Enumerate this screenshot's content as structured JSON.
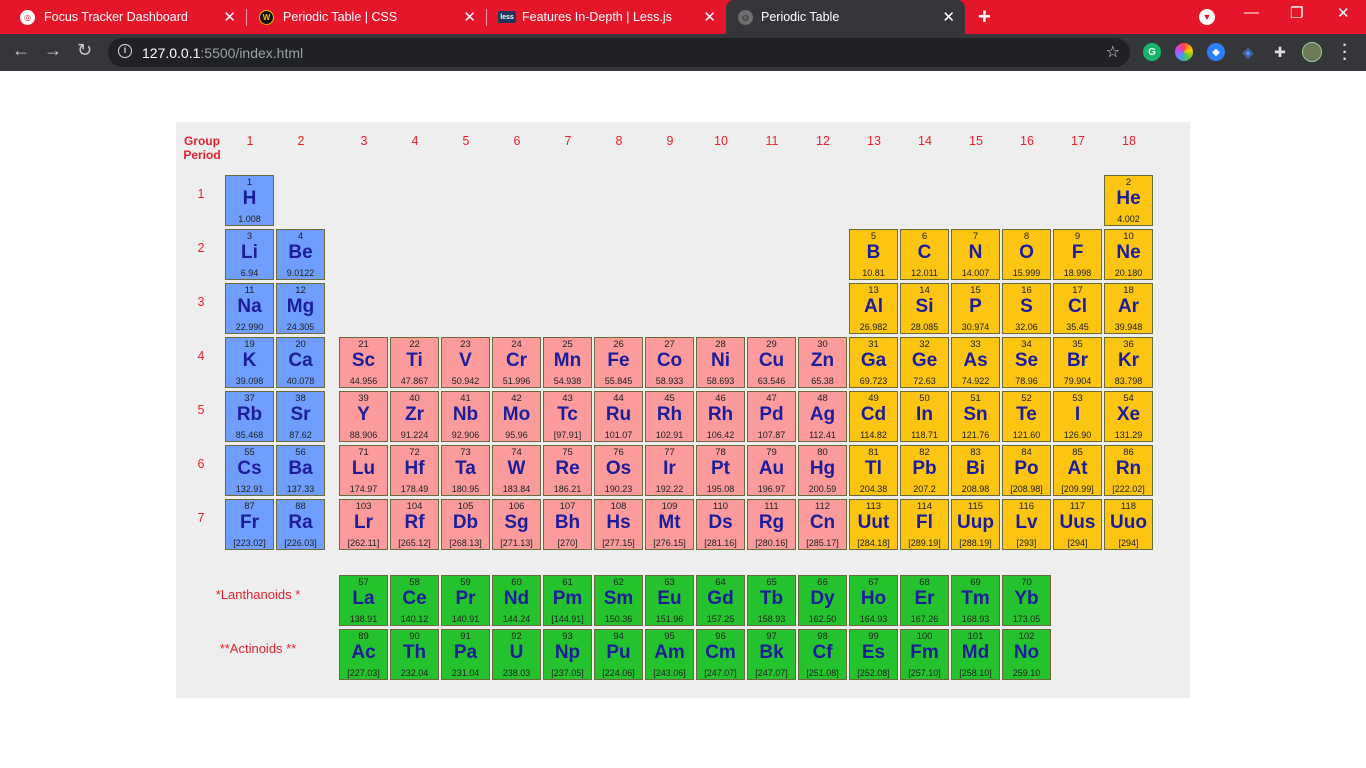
{
  "browser": {
    "tabs": [
      {
        "title": "Focus Tracker Dashboard",
        "icon": "focus-tracker-icon"
      },
      {
        "title": "Periodic Table | CSS",
        "icon": "css-icon"
      },
      {
        "title": "Features In-Depth | Less.js",
        "icon": "less-icon"
      },
      {
        "title": "Periodic Table",
        "icon": "globe-icon",
        "active": true
      }
    ],
    "url_host": "127.0.0.1",
    "url_path": ":5500/index.html",
    "less_badge": "less"
  },
  "table": {
    "group_label": "Group",
    "period_label": "Period",
    "groups": [
      "1",
      "2",
      "3",
      "4",
      "5",
      "6",
      "7",
      "8",
      "9",
      "10",
      "11",
      "12",
      "13",
      "14",
      "15",
      "16",
      "17",
      "18"
    ],
    "periods": [
      "1",
      "2",
      "3",
      "4",
      "5",
      "6",
      "7"
    ],
    "lanthanoids_label": "*Lanthanoids *",
    "actinoids_label": "**Actinoids **",
    "colors": {
      "alkali": "#6f9eff",
      "transition": "#fb9b9b",
      "other": "#fcc512",
      "fblock": "#24c32d",
      "header": "#e8222d"
    },
    "elements": [
      {
        "n": "1",
        "s": "H",
        "m": "1.008",
        "g": 1,
        "p": 1,
        "c": "alkali"
      },
      {
        "n": "2",
        "s": "He",
        "m": "4.002",
        "g": 18,
        "p": 1,
        "c": "other"
      },
      {
        "n": "3",
        "s": "Li",
        "m": "6.94",
        "g": 1,
        "p": 2,
        "c": "alkali"
      },
      {
        "n": "4",
        "s": "Be",
        "m": "9.0122",
        "g": 2,
        "p": 2,
        "c": "alkali"
      },
      {
        "n": "5",
        "s": "B",
        "m": "10.81",
        "g": 13,
        "p": 2,
        "c": "other"
      },
      {
        "n": "6",
        "s": "C",
        "m": "12.011",
        "g": 14,
        "p": 2,
        "c": "other"
      },
      {
        "n": "7",
        "s": "N",
        "m": "14.007",
        "g": 15,
        "p": 2,
        "c": "other"
      },
      {
        "n": "8",
        "s": "O",
        "m": "15.999",
        "g": 16,
        "p": 2,
        "c": "other"
      },
      {
        "n": "9",
        "s": "F",
        "m": "18.998",
        "g": 17,
        "p": 2,
        "c": "other"
      },
      {
        "n": "10",
        "s": "Ne",
        "m": "20.180",
        "g": 18,
        "p": 2,
        "c": "other"
      },
      {
        "n": "11",
        "s": "Na",
        "m": "22.990",
        "g": 1,
        "p": 3,
        "c": "alkali"
      },
      {
        "n": "12",
        "s": "Mg",
        "m": "24.305",
        "g": 2,
        "p": 3,
        "c": "alkali"
      },
      {
        "n": "13",
        "s": "Al",
        "m": "26.982",
        "g": 13,
        "p": 3,
        "c": "other"
      },
      {
        "n": "14",
        "s": "Si",
        "m": "28.085",
        "g": 14,
        "p": 3,
        "c": "other"
      },
      {
        "n": "15",
        "s": "P",
        "m": "30.974",
        "g": 15,
        "p": 3,
        "c": "other"
      },
      {
        "n": "16",
        "s": "S",
        "m": "32.06",
        "g": 16,
        "p": 3,
        "c": "other"
      },
      {
        "n": "17",
        "s": "Cl",
        "m": "35.45",
        "g": 17,
        "p": 3,
        "c": "other"
      },
      {
        "n": "18",
        "s": "Ar",
        "m": "39.948",
        "g": 18,
        "p": 3,
        "c": "other"
      },
      {
        "n": "19",
        "s": "K",
        "m": "39.098",
        "g": 1,
        "p": 4,
        "c": "alkali"
      },
      {
        "n": "20",
        "s": "Ca",
        "m": "40.078",
        "g": 2,
        "p": 4,
        "c": "alkali"
      },
      {
        "n": "21",
        "s": "Sc",
        "m": "44.956",
        "g": 3,
        "p": 4,
        "c": "transition"
      },
      {
        "n": "22",
        "s": "Ti",
        "m": "47.867",
        "g": 4,
        "p": 4,
        "c": "transition"
      },
      {
        "n": "23",
        "s": "V",
        "m": "50.942",
        "g": 5,
        "p": 4,
        "c": "transition"
      },
      {
        "n": "24",
        "s": "Cr",
        "m": "51.996",
        "g": 6,
        "p": 4,
        "c": "transition"
      },
      {
        "n": "25",
        "s": "Mn",
        "m": "54.938",
        "g": 7,
        "p": 4,
        "c": "transition"
      },
      {
        "n": "26",
        "s": "Fe",
        "m": "55.845",
        "g": 8,
        "p": 4,
        "c": "transition"
      },
      {
        "n": "27",
        "s": "Co",
        "m": "58.933",
        "g": 9,
        "p": 4,
        "c": "transition"
      },
      {
        "n": "28",
        "s": "Ni",
        "m": "58.693",
        "g": 10,
        "p": 4,
        "c": "transition"
      },
      {
        "n": "29",
        "s": "Cu",
        "m": "63.546",
        "g": 11,
        "p": 4,
        "c": "transition"
      },
      {
        "n": "30",
        "s": "Zn",
        "m": "65.38",
        "g": 12,
        "p": 4,
        "c": "transition"
      },
      {
        "n": "31",
        "s": "Ga",
        "m": "69.723",
        "g": 13,
        "p": 4,
        "c": "other"
      },
      {
        "n": "32",
        "s": "Ge",
        "m": "72.63",
        "g": 14,
        "p": 4,
        "c": "other"
      },
      {
        "n": "33",
        "s": "As",
        "m": "74.922",
        "g": 15,
        "p": 4,
        "c": "other"
      },
      {
        "n": "34",
        "s": "Se",
        "m": "78.96",
        "g": 16,
        "p": 4,
        "c": "other"
      },
      {
        "n": "35",
        "s": "Br",
        "m": "79.904",
        "g": 17,
        "p": 4,
        "c": "other"
      },
      {
        "n": "36",
        "s": "Kr",
        "m": "83.798",
        "g": 18,
        "p": 4,
        "c": "other"
      },
      {
        "n": "37",
        "s": "Rb",
        "m": "85.468",
        "g": 1,
        "p": 5,
        "c": "alkali"
      },
      {
        "n": "38",
        "s": "Sr",
        "m": "87.62",
        "g": 2,
        "p": 5,
        "c": "alkali"
      },
      {
        "n": "39",
        "s": "Y",
        "m": "88.906",
        "g": 3,
        "p": 5,
        "c": "transition"
      },
      {
        "n": "40",
        "s": "Zr",
        "m": "91.224",
        "g": 4,
        "p": 5,
        "c": "transition"
      },
      {
        "n": "41",
        "s": "Nb",
        "m": "92.906",
        "g": 5,
        "p": 5,
        "c": "transition"
      },
      {
        "n": "42",
        "s": "Mo",
        "m": "95.96",
        "g": 6,
        "p": 5,
        "c": "transition"
      },
      {
        "n": "43",
        "s": "Tc",
        "m": "[97.91]",
        "g": 7,
        "p": 5,
        "c": "transition"
      },
      {
        "n": "44",
        "s": "Ru",
        "m": "101.07",
        "g": 8,
        "p": 5,
        "c": "transition"
      },
      {
        "n": "45",
        "s": "Rh",
        "m": "102.91",
        "g": 9,
        "p": 5,
        "c": "transition"
      },
      {
        "n": "46",
        "s": "Rh",
        "m": "106.42",
        "g": 10,
        "p": 5,
        "c": "transition"
      },
      {
        "n": "47",
        "s": "Pd",
        "m": "107.87",
        "g": 11,
        "p": 5,
        "c": "transition"
      },
      {
        "n": "48",
        "s": "Ag",
        "m": "112.41",
        "g": 12,
        "p": 5,
        "c": "transition"
      },
      {
        "n": "49",
        "s": "Cd",
        "m": "114.82",
        "g": 13,
        "p": 5,
        "c": "other"
      },
      {
        "n": "50",
        "s": "In",
        "m": "118.71",
        "g": 14,
        "p": 5,
        "c": "other"
      },
      {
        "n": "51",
        "s": "Sn",
        "m": "121.76",
        "g": 15,
        "p": 5,
        "c": "other"
      },
      {
        "n": "52",
        "s": "Te",
        "m": "121.60",
        "g": 16,
        "p": 5,
        "c": "other"
      },
      {
        "n": "53",
        "s": "I",
        "m": "126.90",
        "g": 17,
        "p": 5,
        "c": "other"
      },
      {
        "n": "54",
        "s": "Xe",
        "m": "131.29",
        "g": 18,
        "p": 5,
        "c": "other"
      },
      {
        "n": "55",
        "s": "Cs",
        "m": "132.91",
        "g": 1,
        "p": 6,
        "c": "alkali"
      },
      {
        "n": "56",
        "s": "Ba",
        "m": "137.33",
        "g": 2,
        "p": 6,
        "c": "alkali"
      },
      {
        "n": "71",
        "s": "Lu",
        "m": "174.97",
        "g": 3,
        "p": 6,
        "c": "transition"
      },
      {
        "n": "72",
        "s": "Hf",
        "m": "178.49",
        "g": 4,
        "p": 6,
        "c": "transition"
      },
      {
        "n": "73",
        "s": "Ta",
        "m": "180.95",
        "g": 5,
        "p": 6,
        "c": "transition"
      },
      {
        "n": "74",
        "s": "W",
        "m": "183.84",
        "g": 6,
        "p": 6,
        "c": "transition"
      },
      {
        "n": "75",
        "s": "Re",
        "m": "186.21",
        "g": 7,
        "p": 6,
        "c": "transition"
      },
      {
        "n": "76",
        "s": "Os",
        "m": "190.23",
        "g": 8,
        "p": 6,
        "c": "transition"
      },
      {
        "n": "77",
        "s": "Ir",
        "m": "192.22",
        "g": 9,
        "p": 6,
        "c": "transition"
      },
      {
        "n": "78",
        "s": "Pt",
        "m": "195.08",
        "g": 10,
        "p": 6,
        "c": "transition"
      },
      {
        "n": "79",
        "s": "Au",
        "m": "196.97",
        "g": 11,
        "p": 6,
        "c": "transition"
      },
      {
        "n": "80",
        "s": "Hg",
        "m": "200.59",
        "g": 12,
        "p": 6,
        "c": "transition"
      },
      {
        "n": "81",
        "s": "Tl",
        "m": "204.38",
        "g": 13,
        "p": 6,
        "c": "other"
      },
      {
        "n": "82",
        "s": "Pb",
        "m": "207.2",
        "g": 14,
        "p": 6,
        "c": "other"
      },
      {
        "n": "83",
        "s": "Bi",
        "m": "208.98",
        "g": 15,
        "p": 6,
        "c": "other"
      },
      {
        "n": "84",
        "s": "Po",
        "m": "[208.98]",
        "g": 16,
        "p": 6,
        "c": "other"
      },
      {
        "n": "85",
        "s": "At",
        "m": "[209.99]",
        "g": 17,
        "p": 6,
        "c": "other"
      },
      {
        "n": "86",
        "s": "Rn",
        "m": "[222.02]",
        "g": 18,
        "p": 6,
        "c": "other"
      },
      {
        "n": "87",
        "s": "Fr",
        "m": "[223.02]",
        "g": 1,
        "p": 7,
        "c": "alkali"
      },
      {
        "n": "88",
        "s": "Ra",
        "m": "[226.03]",
        "g": 2,
        "p": 7,
        "c": "alkali"
      },
      {
        "n": "103",
        "s": "Lr",
        "m": "[262.11]",
        "g": 3,
        "p": 7,
        "c": "transition"
      },
      {
        "n": "104",
        "s": "Rf",
        "m": "[265.12]",
        "g": 4,
        "p": 7,
        "c": "transition"
      },
      {
        "n": "105",
        "s": "Db",
        "m": "[268.13]",
        "g": 5,
        "p": 7,
        "c": "transition"
      },
      {
        "n": "106",
        "s": "Sg",
        "m": "[271.13]",
        "g": 6,
        "p": 7,
        "c": "transition"
      },
      {
        "n": "107",
        "s": "Bh",
        "m": "[270]",
        "g": 7,
        "p": 7,
        "c": "transition"
      },
      {
        "n": "108",
        "s": "Hs",
        "m": "[277.15]",
        "g": 8,
        "p": 7,
        "c": "transition"
      },
      {
        "n": "109",
        "s": "Mt",
        "m": "[276.15]",
        "g": 9,
        "p": 7,
        "c": "transition"
      },
      {
        "n": "110",
        "s": "Ds",
        "m": "[281.16]",
        "g": 10,
        "p": 7,
        "c": "transition"
      },
      {
        "n": "111",
        "s": "Rg",
        "m": "[280.16]",
        "g": 11,
        "p": 7,
        "c": "transition"
      },
      {
        "n": "112",
        "s": "Cn",
        "m": "[285.17]",
        "g": 12,
        "p": 7,
        "c": "transition"
      },
      {
        "n": "113",
        "s": "Uut",
        "m": "[284.18]",
        "g": 13,
        "p": 7,
        "c": "other"
      },
      {
        "n": "114",
        "s": "Fl",
        "m": "[289.19]",
        "g": 14,
        "p": 7,
        "c": "other"
      },
      {
        "n": "115",
        "s": "Uup",
        "m": "[288.19]",
        "g": 15,
        "p": 7,
        "c": "other"
      },
      {
        "n": "116",
        "s": "Lv",
        "m": "[293]",
        "g": 16,
        "p": 7,
        "c": "other"
      },
      {
        "n": "117",
        "s": "Uus",
        "m": "[294]",
        "g": 17,
        "p": 7,
        "c": "other"
      },
      {
        "n": "118",
        "s": "Uuo",
        "m": "[294]",
        "g": 18,
        "p": 7,
        "c": "other"
      }
    ],
    "lanthanoids": [
      {
        "n": "57",
        "s": "La",
        "m": "138.91"
      },
      {
        "n": "58",
        "s": "Ce",
        "m": "140.12"
      },
      {
        "n": "59",
        "s": "Pr",
        "m": "140.91"
      },
      {
        "n": "60",
        "s": "Nd",
        "m": "144.24"
      },
      {
        "n": "61",
        "s": "Pm",
        "m": "[144.91]"
      },
      {
        "n": "62",
        "s": "Sm",
        "m": "150.36"
      },
      {
        "n": "63",
        "s": "Eu",
        "m": "151.96"
      },
      {
        "n": "64",
        "s": "Gd",
        "m": "157.25"
      },
      {
        "n": "65",
        "s": "Tb",
        "m": "158.93"
      },
      {
        "n": "66",
        "s": "Dy",
        "m": "162.50"
      },
      {
        "n": "67",
        "s": "Ho",
        "m": "164.93"
      },
      {
        "n": "68",
        "s": "Er",
        "m": "167.26"
      },
      {
        "n": "69",
        "s": "Tm",
        "m": "168.93"
      },
      {
        "n": "70",
        "s": "Yb",
        "m": "173.05"
      }
    ],
    "actinoids": [
      {
        "n": "89",
        "s": "Ac",
        "m": "[227.03]"
      },
      {
        "n": "90",
        "s": "Th",
        "m": "232.04"
      },
      {
        "n": "91",
        "s": "Pa",
        "m": "231.04"
      },
      {
        "n": "92",
        "s": "U",
        "m": "238.03"
      },
      {
        "n": "93",
        "s": "Np",
        "m": "[237.05]"
      },
      {
        "n": "94",
        "s": "Pu",
        "m": "[224.06]"
      },
      {
        "n": "95",
        "s": "Am",
        "m": "[243.06]"
      },
      {
        "n": "96",
        "s": "Cm",
        "m": "[247.07]"
      },
      {
        "n": "97",
        "s": "Bk",
        "m": "[247.07]"
      },
      {
        "n": "98",
        "s": "Cf",
        "m": "[251.08]"
      },
      {
        "n": "99",
        "s": "Es",
        "m": "[252.08]"
      },
      {
        "n": "100",
        "s": "Fm",
        "m": "[257.10]"
      },
      {
        "n": "101",
        "s": "Md",
        "m": "[258.10]"
      },
      {
        "n": "102",
        "s": "No",
        "m": "259.10"
      }
    ]
  }
}
